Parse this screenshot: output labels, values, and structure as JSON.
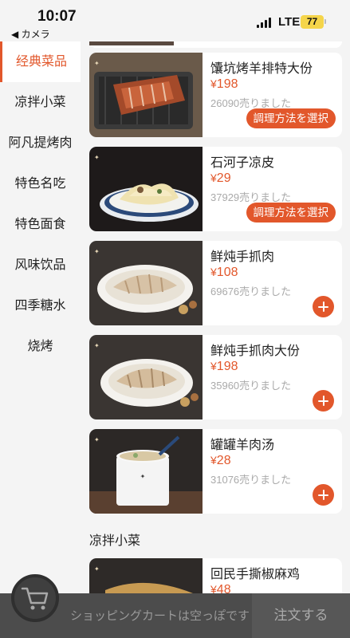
{
  "status": {
    "time": "10:07",
    "back_label": "◀ カメラ",
    "network": "LTE",
    "battery": "77"
  },
  "sidebar": {
    "items": [
      {
        "label": "经典菜品",
        "active": true
      },
      {
        "label": "凉拌小菜"
      },
      {
        "label": "阿凡提烤肉"
      },
      {
        "label": "特色名吃"
      },
      {
        "label": "特色面食"
      },
      {
        "label": "风味饮品"
      },
      {
        "label": "四季糖水"
      },
      {
        "label": "烧烤"
      }
    ]
  },
  "menu": {
    "currency": "¥",
    "items": [
      {
        "name": "馕坑烤羊排特大份",
        "price": "198",
        "sold": "26090売りました",
        "action": "調理方法を選択"
      },
      {
        "name": "石河子凉皮",
        "price": "29",
        "sold": "37929売りました",
        "action": "調理方法を選択"
      },
      {
        "name": "鲜炖手抓肉",
        "price": "108",
        "sold": "69676売りました",
        "action": "add"
      },
      {
        "name": "鲜炖手抓肉大份",
        "price": "198",
        "sold": "35960売りました",
        "action": "add"
      },
      {
        "name": "罐罐羊肉汤",
        "price": "28",
        "sold": "31076売りました",
        "action": "add"
      },
      {
        "name": "回民手撕椒麻鸡",
        "price": "48",
        "sold": "",
        "action": ""
      }
    ],
    "section_title": "凉拌小菜"
  },
  "cart": {
    "empty_message": "ショッピングカートは空っぽです",
    "checkout_label": "注文する"
  },
  "colors": {
    "accent": "#e2572b",
    "cart_bar": "#4c4c4c"
  }
}
